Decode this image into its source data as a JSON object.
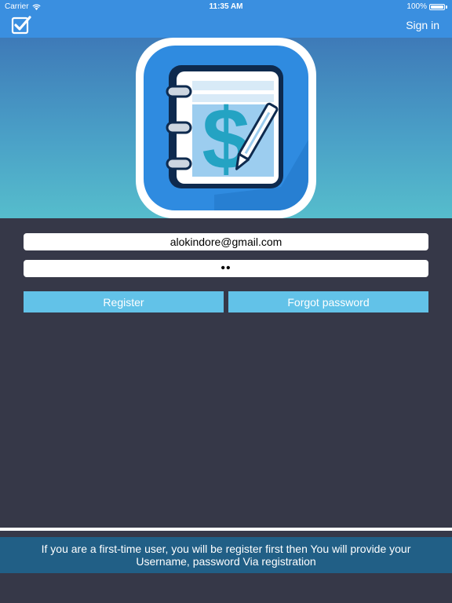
{
  "status_bar": {
    "carrier": "Carrier",
    "time": "11:35 AM",
    "battery": "100%"
  },
  "nav": {
    "sign_in_label": "Sign in",
    "logo_icon": "checkbox-check-icon"
  },
  "hero": {
    "app_icon": "dollar-notebook-pen-icon",
    "symbol": "$"
  },
  "form": {
    "email_value": "alokindore@gmail.com",
    "password_value": "••"
  },
  "buttons": {
    "register_label": "Register",
    "forgot_label": "Forgot password"
  },
  "info": {
    "message": "If you are a first-time user, you will be register first then You will provide your Username, password Via registration"
  },
  "colors": {
    "nav_blue": "#3a8fe0",
    "button_blue": "#62c2e8",
    "background": "#363848",
    "banner": "#215f86"
  }
}
